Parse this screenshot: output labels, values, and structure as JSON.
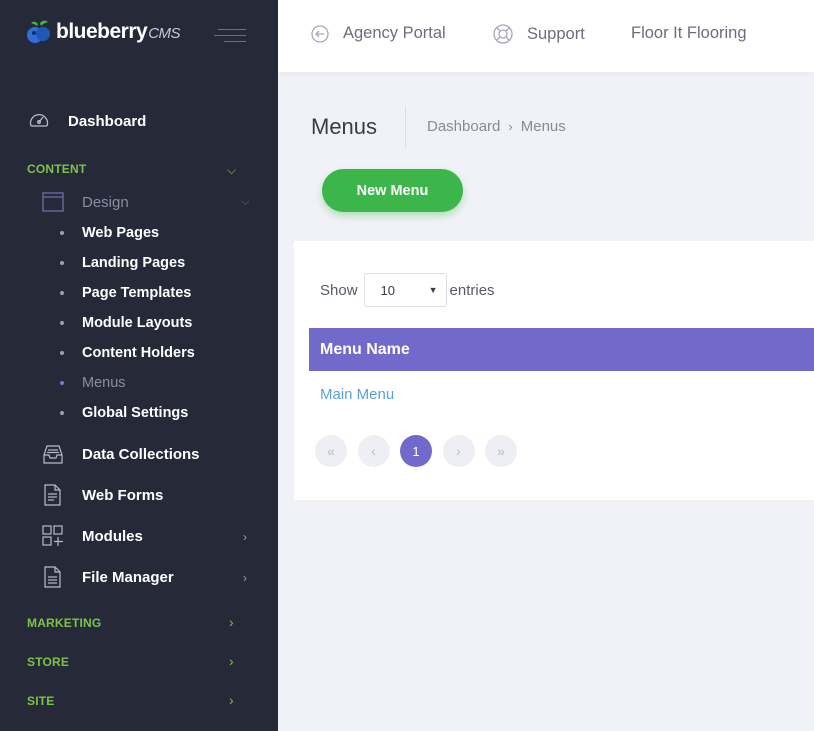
{
  "brand": {
    "name": "blueberry",
    "suffix": "CMS"
  },
  "topbar": {
    "items": [
      "Agency Portal",
      "Support",
      "Floor It Flooring"
    ]
  },
  "sidebar": {
    "dashboard": "Dashboard",
    "sections": {
      "content": "CONTENT",
      "marketing": "MARKETING",
      "store": "STORE",
      "site": "SITE"
    },
    "design": "Design",
    "design_items": [
      "Web Pages",
      "Landing Pages",
      "Page Templates",
      "Module Layouts",
      "Content Holders",
      "Menus",
      "Global Settings"
    ],
    "active_item": "Menus",
    "other_items": [
      "Data Collections",
      "Web Forms",
      "Modules",
      "File Manager"
    ]
  },
  "page": {
    "title": "Menus",
    "breadcrumb": [
      "Dashboard",
      "Menus"
    ],
    "new_button": "New Menu"
  },
  "table": {
    "show_label": "Show",
    "entries_value": "10",
    "entries_label": "entries",
    "column": "Menu Name",
    "rows": [
      "Main Menu"
    ]
  },
  "pagination": {
    "current": "1",
    "first": "«",
    "prev": "‹",
    "next": "›",
    "last": "»"
  },
  "colors": {
    "sidebar": "#262938",
    "accent_green": "#3cb54a",
    "section_green": "#7ec24a",
    "header_purple": "#716acb",
    "link_blue": "#5c9fd6"
  }
}
